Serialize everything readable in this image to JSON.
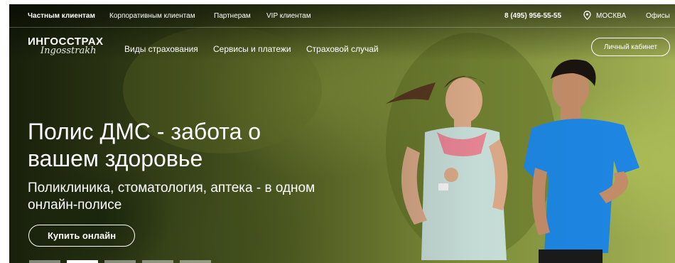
{
  "topbar": {
    "links": [
      "Частным клиентам",
      "Корпоративным клиентам",
      "Партнерам",
      "VIP клиентам"
    ],
    "phone": "8 (495) 956-55-55",
    "city": "МОСКВА",
    "offices": "Офисы"
  },
  "logo": {
    "main": "ИНГОССТРАХ",
    "script": "Ingosstrakh"
  },
  "mainnav": {
    "items": [
      "Виды страхования",
      "Сервисы и платежи",
      "Страховой случай"
    ]
  },
  "account": {
    "label": "Личный кабинет"
  },
  "hero": {
    "title": "Полис ДМС - забота о вашем здоровье",
    "subtitle": "Поликлиника, стоматология, аптека - в одном онлайн-полисе",
    "cta": "Купить онлайн"
  },
  "slider": {
    "count": 5,
    "active": 2
  },
  "colors": {
    "text": "#ffffff",
    "foliage": "#6d7d2e",
    "shirt_man": "#1e88e5",
    "top_woman": "#c9e3df"
  }
}
